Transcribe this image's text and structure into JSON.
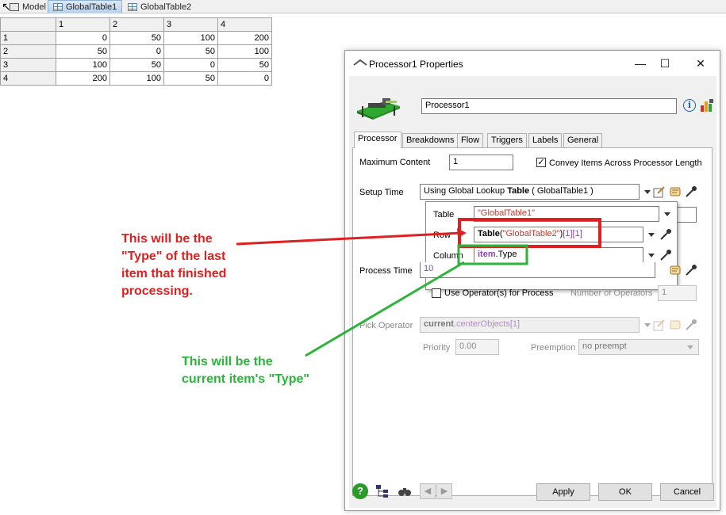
{
  "tabs": [
    {
      "label": "Model"
    },
    {
      "label": "GlobalTable1"
    },
    {
      "label": "GlobalTable2"
    }
  ],
  "table": {
    "col_headers": [
      "1",
      "2",
      "3",
      "4"
    ],
    "rows": [
      {
        "header": "1",
        "cells": [
          "0",
          "50",
          "100",
          "200"
        ]
      },
      {
        "header": "2",
        "cells": [
          "50",
          "0",
          "50",
          "100"
        ]
      },
      {
        "header": "3",
        "cells": [
          "100",
          "50",
          "0",
          "50"
        ]
      },
      {
        "header": "4",
        "cells": [
          "200",
          "100",
          "50",
          "0"
        ]
      }
    ]
  },
  "dialog": {
    "title": "Processor1  Properties",
    "name_value": "Processor1",
    "tabs": [
      "Processor",
      "Breakdowns",
      "Flow",
      "Triggers",
      "Labels",
      "General"
    ],
    "max_content_label": "Maximum Content",
    "max_content_value": "1",
    "convey_label": "Convey Items Across Processor Length",
    "setup_time_label": "Setup Time",
    "setup_time_prefix": "Using Global Lookup ",
    "setup_time_bold": "Table",
    "setup_time_suffix": " ( GlobalTable1 )",
    "popup": {
      "table_label": "Table",
      "table_value": "\"GlobalTable1\"",
      "row_label": "Row",
      "row_func": "Table",
      "row_arg": "\"GlobalTable2\"",
      "row_idx": "[1][1]",
      "column_label": "Column",
      "column_obj": "item",
      "column_prop": ".Type"
    },
    "process_time_label": "Process Time",
    "process_time_value": "10",
    "use_operator_label": "Use Operator(s) for Process",
    "num_operators_label": "Number of Operators",
    "num_operators_value": "1",
    "pick_operator_label": "Pick Operator",
    "pick_operator_obj": "current",
    "pick_operator_member": ".centerObjects",
    "pick_operator_idx": "[1]",
    "priority_label": "Priority",
    "priority_value": "0.00",
    "preemption_label": "Preemption",
    "preemption_value": "no preempt",
    "apply": "Apply",
    "ok": "OK",
    "cancel": "Cancel"
  },
  "annotations": {
    "red_text": [
      "This will be the",
      "\"Type\" of the last",
      "item that finished",
      "processing."
    ],
    "green_text": [
      "This will be the",
      "current item's \"Type\""
    ]
  },
  "colors": {
    "annotation_red": "#e02020",
    "annotation_green": "#2bb33a",
    "accent": "#1a5fb4"
  }
}
